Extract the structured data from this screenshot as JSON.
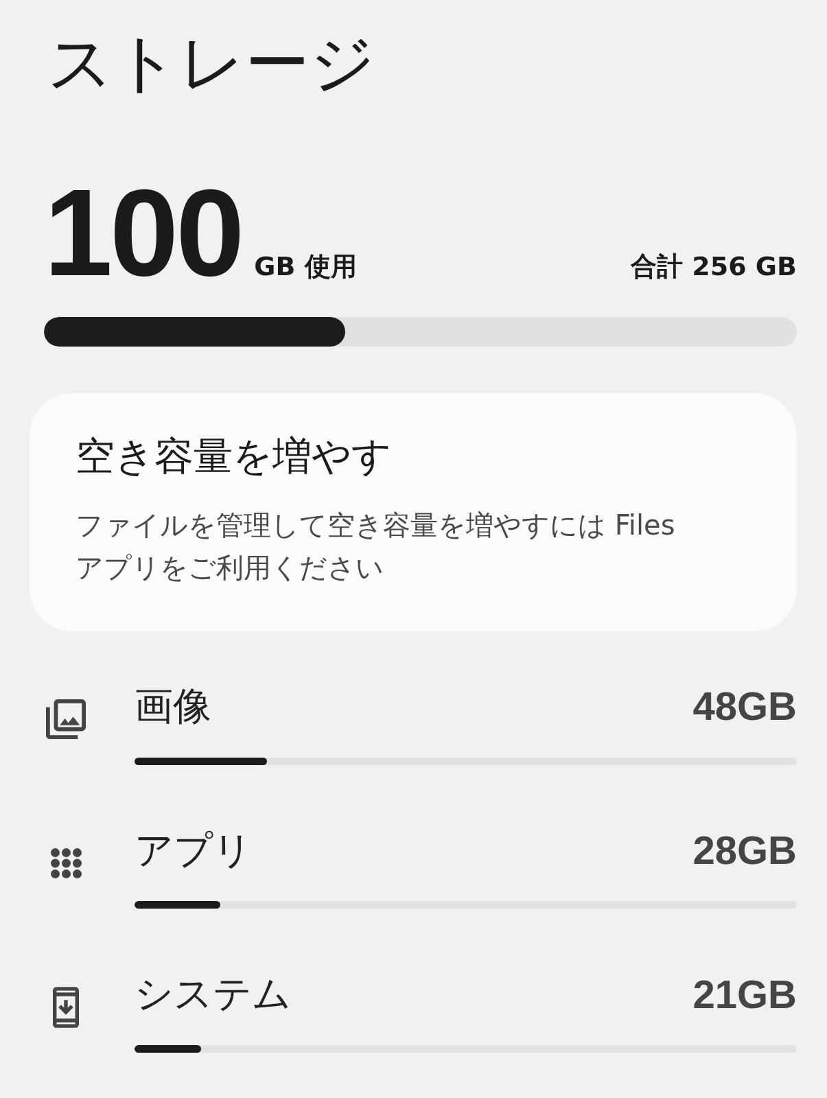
{
  "title": "ストレージ",
  "usage": {
    "used": "100",
    "used_unit": "GB 使用",
    "total": "合計 256 GB",
    "level": 0.4
  },
  "tip_card": {
    "title": "空き容量を増やす",
    "body": "ファイルを管理して空き容量を増やすには Files アプリをご利用ください"
  },
  "categories": [
    {
      "kind": "images",
      "name": "画像",
      "size": "48GB",
      "level": 0.2
    },
    {
      "kind": "apps",
      "name": "アプリ",
      "size": "28GB",
      "level": 0.13
    },
    {
      "kind": "system",
      "name": "システム",
      "size": "21GB",
      "level": 0.1
    }
  ]
}
